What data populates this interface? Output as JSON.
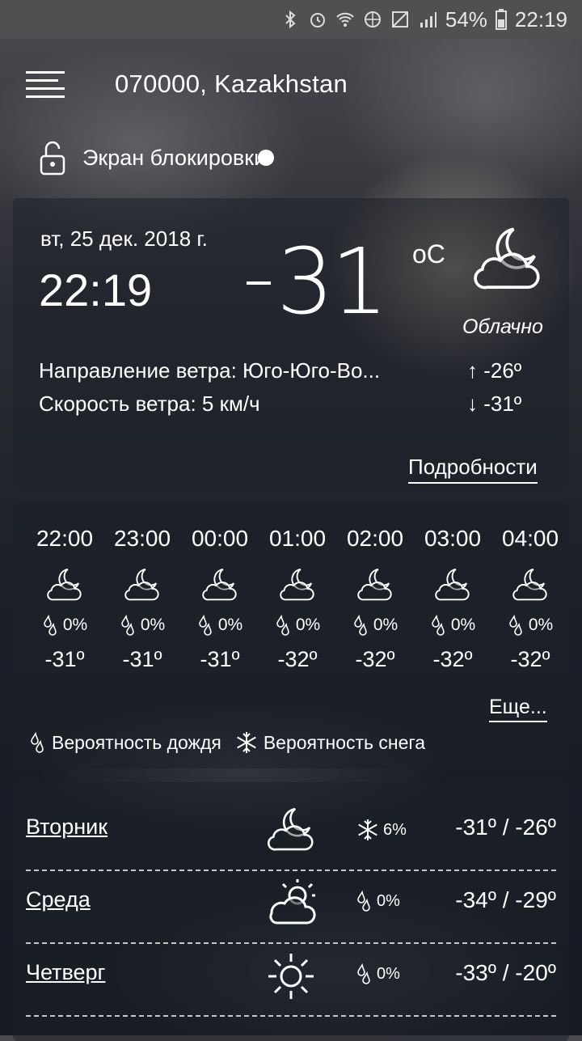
{
  "status_bar": {
    "battery": "54%",
    "time": "22:19"
  },
  "header": {
    "location": "070000, Kazakhstan",
    "lock_label": "Экран блокировки"
  },
  "current": {
    "date": "вт, 25 дек. 2018 г.",
    "time": "22:19",
    "temp_sign": "-",
    "temp_value": "31",
    "temp_unit": "oC",
    "condition": "Облачно",
    "wind_direction": "Направление ветра: Юго-Юго-Во...",
    "wind_speed": "Скорость ветра: 5 км/ч",
    "high": "↑  -26º",
    "low": "↓  -31º",
    "details_label": "Подробности"
  },
  "hourly": [
    {
      "time": "22:00",
      "precip": "0%",
      "temp": "-31º"
    },
    {
      "time": "23:00",
      "precip": "0%",
      "temp": "-31º"
    },
    {
      "time": "00:00",
      "precip": "0%",
      "temp": "-31º"
    },
    {
      "time": "01:00",
      "precip": "0%",
      "temp": "-32º"
    },
    {
      "time": "02:00",
      "precip": "0%",
      "temp": "-32º"
    },
    {
      "time": "03:00",
      "precip": "0%",
      "temp": "-32º"
    },
    {
      "time": "04:00",
      "precip": "0%",
      "temp": "-32º"
    }
  ],
  "more_label": "Еще...",
  "legend": {
    "rain": "Вероятность дождя",
    "snow": "Вероятность снега"
  },
  "daily": [
    {
      "day": "Вторник",
      "icon": "cloudy-night-icon",
      "precip_type": "snow",
      "precip": "6%",
      "temps": "-31º / -26º"
    },
    {
      "day": "Среда",
      "icon": "partly-cloudy-icon",
      "precip_type": "rain",
      "precip": "0%",
      "temps": "-34º / -29º"
    },
    {
      "day": "Четверг",
      "icon": "sun-icon",
      "precip_type": "rain",
      "precip": "0%",
      "temps": "-33º / -20º"
    }
  ]
}
